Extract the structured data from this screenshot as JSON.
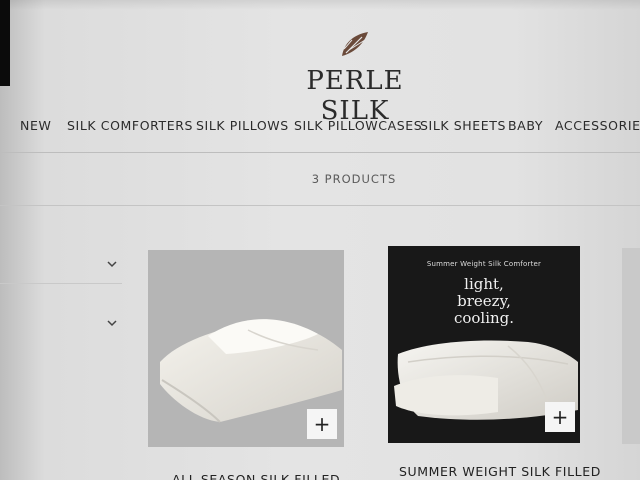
{
  "brand": {
    "name": "PERLE SILK"
  },
  "nav": {
    "items": [
      "NEW",
      "SILK COMFORTERS",
      "SILK PILLOWS",
      "SILK PILLOWCASES",
      "SILK SHEETS",
      "BABY",
      "ACCESSORIES"
    ]
  },
  "collection": {
    "product_count": "3 PRODUCTS"
  },
  "filters": [
    {
      "icon": "chevron-down-icon"
    },
    {
      "icon": "chevron-down-icon"
    }
  ],
  "products": [
    {
      "caption": "ALL SEASON SILK FILLED",
      "button_label": "+"
    },
    {
      "caption": "SUMMER WEIGHT SILK FILLED",
      "button_label": "+",
      "image_text_small": "Summer Weight Silk Comforter",
      "image_text_lines": [
        "light,",
        "breezy,",
        "cooling."
      ]
    }
  ]
}
